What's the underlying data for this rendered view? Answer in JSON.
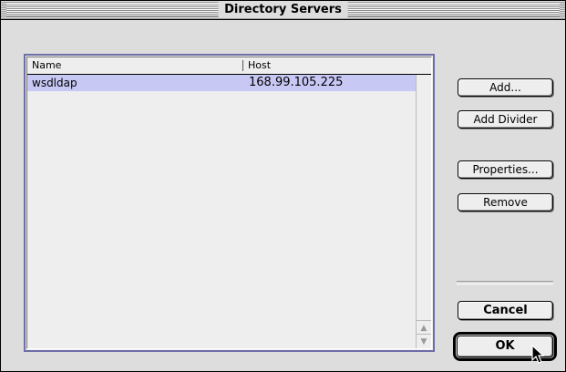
{
  "window": {
    "title": "Directory Servers"
  },
  "list": {
    "columns": [
      "Name",
      "Host"
    ],
    "rows": [
      {
        "name": "wsdldap",
        "host": "168.99.105.225",
        "selected": true
      }
    ]
  },
  "buttons": {
    "add": "Add...",
    "add_divider": "Add Divider",
    "properties": "Properties...",
    "remove": "Remove",
    "cancel": "Cancel",
    "ok": "OK"
  },
  "colors": {
    "selection": "#c8c8f5",
    "focus_border": "#6d6da8"
  }
}
